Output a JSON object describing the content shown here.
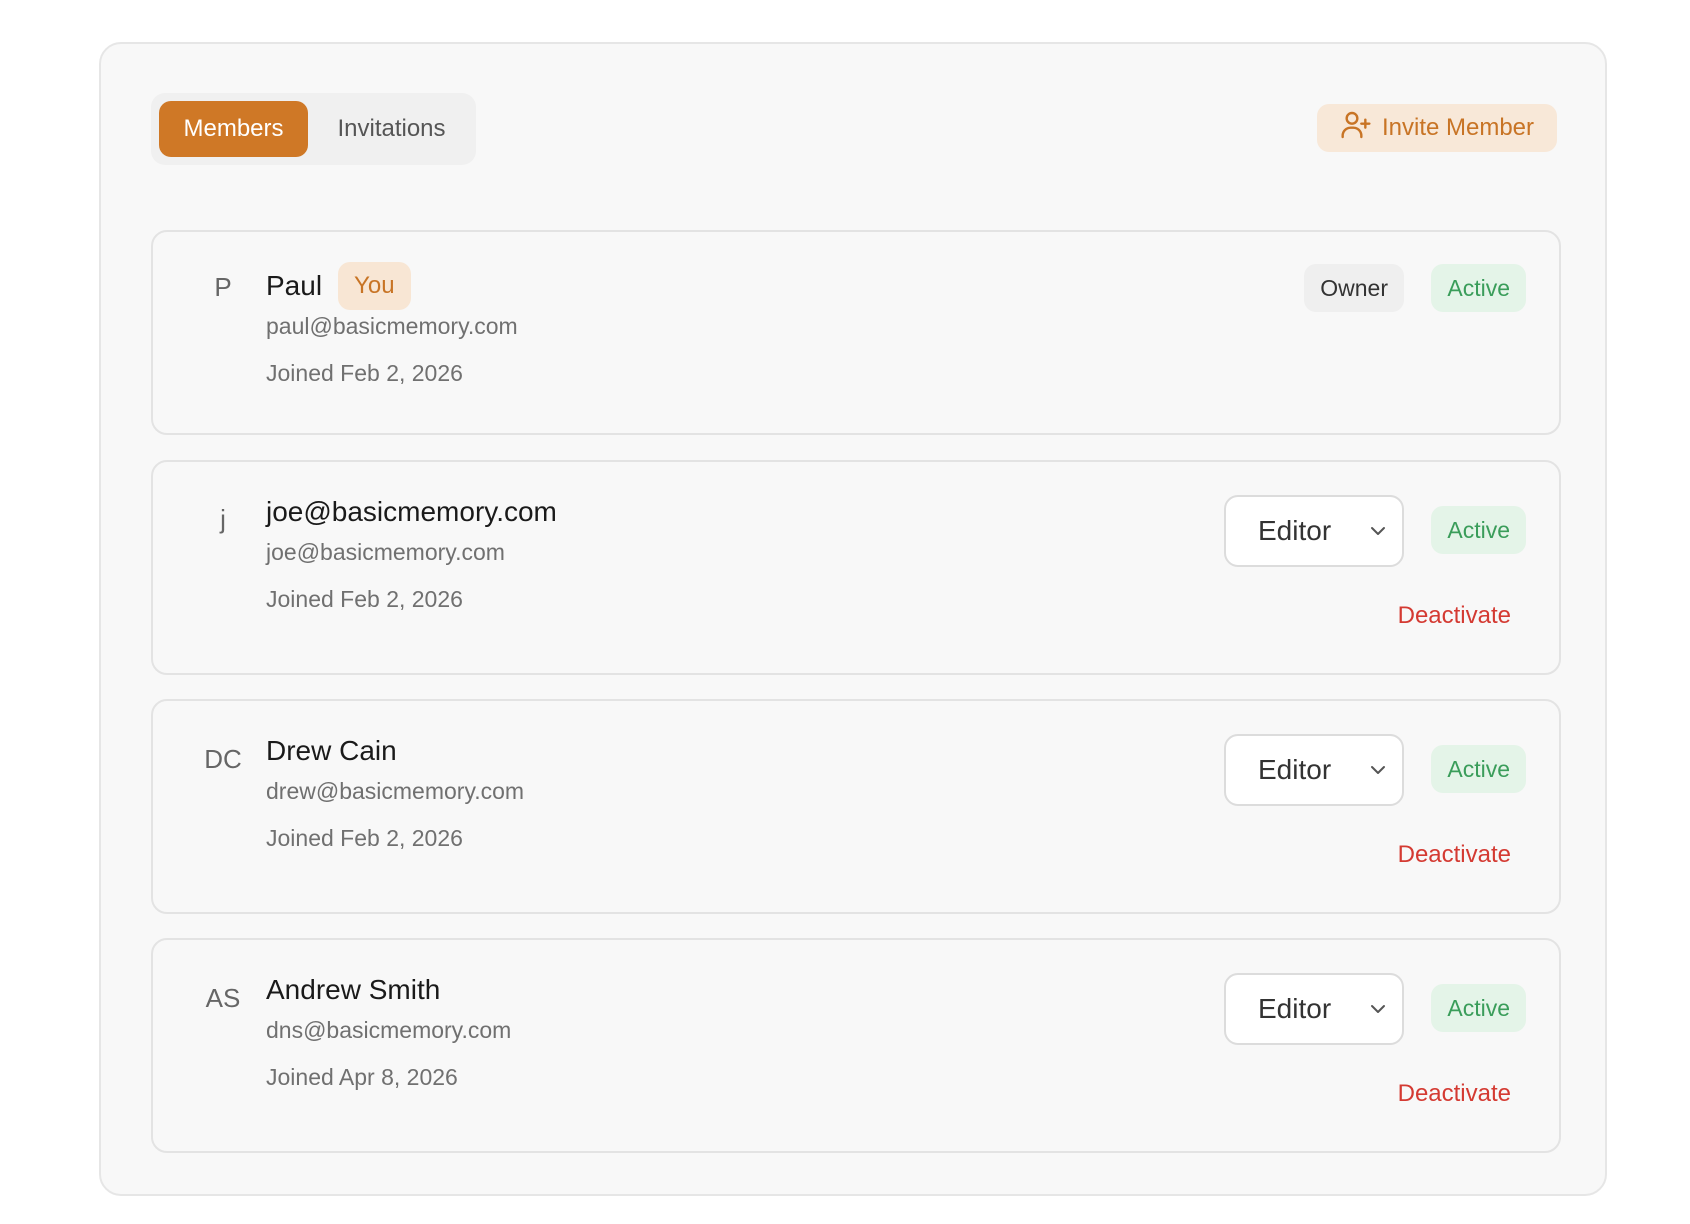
{
  "tabs": [
    {
      "label": "Members",
      "active": true
    },
    {
      "label": "Invitations",
      "active": false
    }
  ],
  "invite_button": {
    "label": "Invite Member",
    "icon": "user-plus-icon"
  },
  "colors": {
    "accent": "#cf7826",
    "active_green": "#3a9d5a",
    "danger_red": "#d43a32"
  },
  "members": [
    {
      "initials": "P",
      "name": "Paul",
      "you_badge": "You",
      "email": "paul@basicmemory.com",
      "joined": "Joined Feb 2, 2026",
      "role": "Owner",
      "status": "Active"
    },
    {
      "initials": "j",
      "name": "joe@basicmemory.com",
      "email": "joe@basicmemory.com",
      "joined": "Joined Feb 2, 2026",
      "role": "Editor",
      "status": "Active",
      "action": "Deactivate"
    },
    {
      "initials": "DC",
      "name": "Drew Cain",
      "email": "drew@basicmemory.com",
      "joined": "Joined Feb 2, 2026",
      "role": "Editor",
      "status": "Active",
      "action": "Deactivate"
    },
    {
      "initials": "AS",
      "name": "Andrew Smith",
      "email": "dns@basicmemory.com",
      "joined": "Joined Apr 8, 2026",
      "role": "Editor",
      "status": "Active",
      "action": "Deactivate"
    }
  ]
}
